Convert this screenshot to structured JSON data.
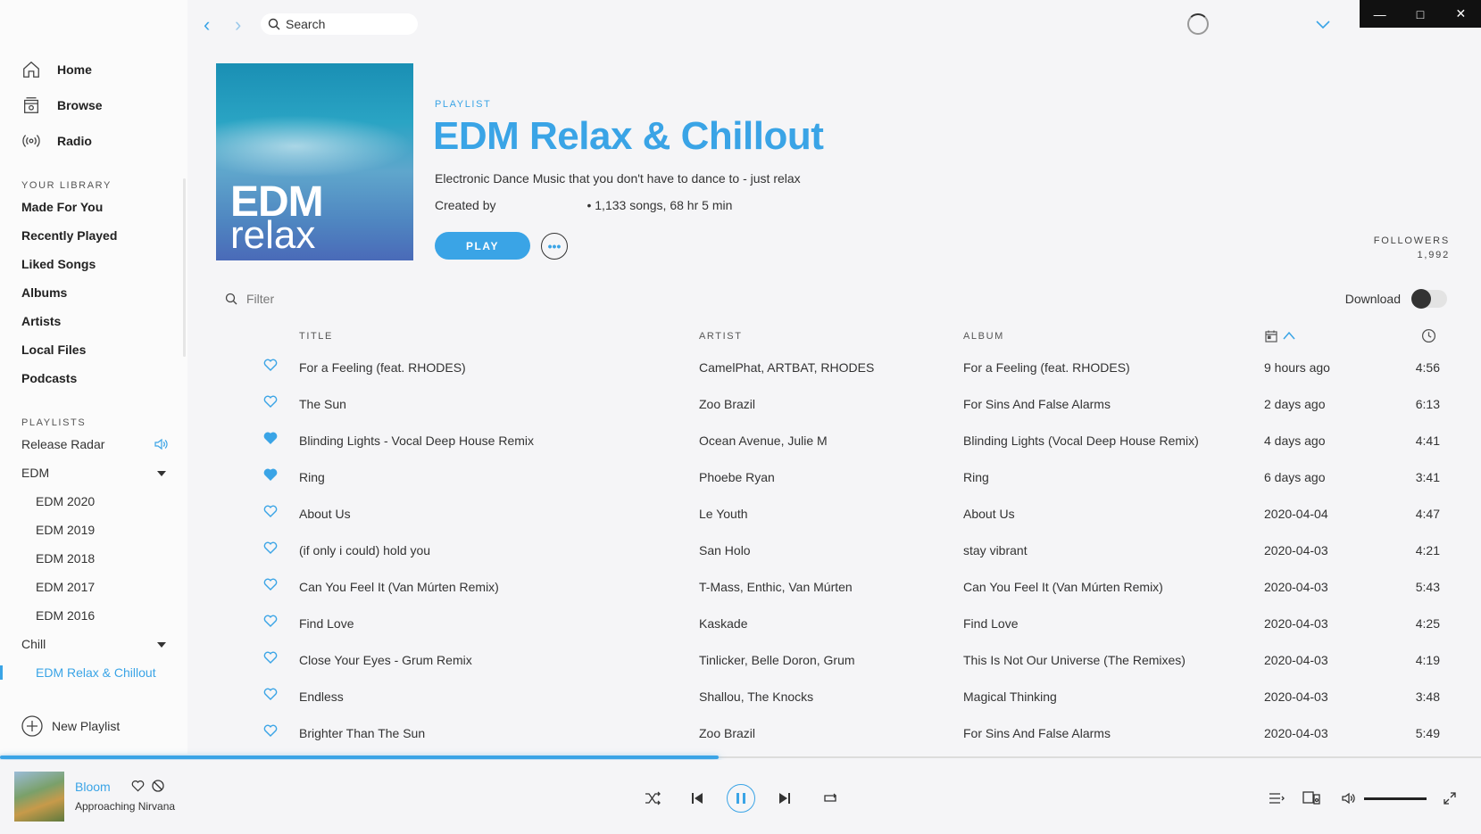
{
  "sidebar": {
    "nav": [
      {
        "label": "Home",
        "icon": "home-icon"
      },
      {
        "label": "Browse",
        "icon": "browse-icon"
      },
      {
        "label": "Radio",
        "icon": "radio-icon"
      }
    ],
    "library_label": "YOUR LIBRARY",
    "library_items": [
      "Made For You",
      "Recently Played",
      "Liked Songs",
      "Albums",
      "Artists",
      "Local Files",
      "Podcasts"
    ],
    "playlists_label": "PLAYLISTS",
    "playlists": {
      "release_radar": "Release Radar",
      "edm_folder": "EDM",
      "edm_children": [
        "EDM 2020",
        "EDM 2019",
        "EDM 2018",
        "EDM 2017",
        "EDM 2016"
      ],
      "chill_folder": "Chill",
      "active": "EDM Relax & Chillout"
    },
    "new_playlist": "New Playlist"
  },
  "topbar": {
    "search_placeholder": "Search"
  },
  "playlist": {
    "type_label": "PLAYLIST",
    "title": "EDM Relax & Chillout",
    "description": "Electronic Dance Music that you don't have to dance to - just relax",
    "created_by": "Created by",
    "stats": "• 1,133 songs, 68 hr 5 min",
    "play_label": "PLAY",
    "followers_label": "FOLLOWERS",
    "followers_count": "1,992",
    "cover_line1": "EDM",
    "cover_line2": "relax"
  },
  "controls": {
    "filter_placeholder": "Filter",
    "download_label": "Download",
    "download_enabled": false
  },
  "table": {
    "headers": {
      "title": "TITLE",
      "artist": "ARTIST",
      "album": "ALBUM"
    },
    "rows": [
      {
        "liked": false,
        "title": "For a Feeling (feat. RHODES)",
        "artist": "CamelPhat, ARTBAT, RHODES",
        "album": "For a Feeling (feat. RHODES)",
        "added": "9 hours ago",
        "duration": "4:56"
      },
      {
        "liked": false,
        "title": "The Sun",
        "artist": "Zoo Brazil",
        "album": "For Sins And False Alarms",
        "added": "2 days ago",
        "duration": "6:13"
      },
      {
        "liked": true,
        "title": "Blinding Lights - Vocal Deep House Remix",
        "artist": "Ocean Avenue, Julie M",
        "album": "Blinding Lights (Vocal Deep House Remix)",
        "added": "4 days ago",
        "duration": "4:41"
      },
      {
        "liked": true,
        "title": "Ring",
        "artist": "Phoebe Ryan",
        "album": "Ring",
        "added": "6 days ago",
        "duration": "3:41"
      },
      {
        "liked": false,
        "title": "About Us",
        "artist": "Le Youth",
        "album": "About Us",
        "added": "2020-04-04",
        "duration": "4:47"
      },
      {
        "liked": false,
        "title": "(if only i could) hold you",
        "artist": "San Holo",
        "album": "stay vibrant",
        "added": "2020-04-03",
        "duration": "4:21"
      },
      {
        "liked": false,
        "title": "Can You Feel It (Van Múrten Remix)",
        "artist": "T-Mass, Enthic, Van Múrten",
        "album": "Can You Feel It (Van Múrten Remix)",
        "added": "2020-04-03",
        "duration": "5:43"
      },
      {
        "liked": false,
        "title": "Find Love",
        "artist": "Kaskade",
        "album": "Find Love",
        "added": "2020-04-03",
        "duration": "4:25"
      },
      {
        "liked": false,
        "title": "Close Your Eyes - Grum Remix",
        "artist": "Tinlicker, Belle Doron, Grum",
        "album": "This Is Not Our Universe (The Remixes)",
        "added": "2020-04-03",
        "duration": "4:19"
      },
      {
        "liked": false,
        "title": "Endless",
        "artist": "Shallou, The Knocks",
        "album": "Magical Thinking",
        "added": "2020-04-03",
        "duration": "3:48"
      },
      {
        "liked": false,
        "title": "Brighter Than The Sun",
        "artist": "Zoo Brazil",
        "album": "For Sins And False Alarms",
        "added": "2020-04-03",
        "duration": "5:49"
      }
    ]
  },
  "now_playing": {
    "title": "Bloom",
    "artist": "Approaching Nirvana",
    "progress_fraction": 0.485,
    "volume_fraction": 1.0
  },
  "colors": {
    "accent": "#3aa4e6",
    "background": "#f5f5f7",
    "sidebar": "#fbfbfb"
  }
}
